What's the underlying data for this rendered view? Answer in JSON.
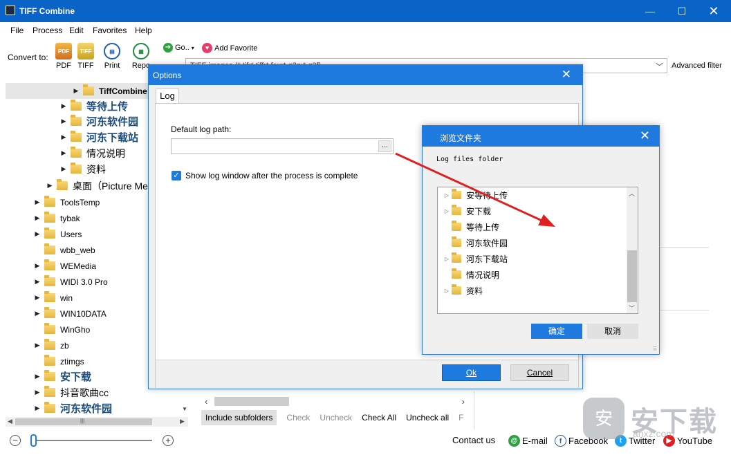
{
  "window": {
    "title": "TIFF Combine",
    "min_glyph": "—",
    "max_glyph": "☐",
    "close_glyph": "✕"
  },
  "menu": [
    "File",
    "Process",
    "Edit",
    "Favorites",
    "Help"
  ],
  "toolbar": {
    "convert_label": "Convert to:",
    "pdf_label": "PDF",
    "pdf_icon_text": "PDF",
    "tiff_label": "TIFF",
    "tiff_icon_text": "TIFF",
    "print_label": "Print",
    "report_label": "Repo",
    "goto_label": "Go..",
    "add_favorite_label": "Add Favorite",
    "filter_value": "TIFF images (*.tif;*.tiff;*.fax;*.g3n;*.g3f)",
    "advanced_filter_label": "Advanced filter"
  },
  "tree": {
    "items": [
      {
        "label": "TiffCombine",
        "style": "bold"
      },
      {
        "label": "等待上传",
        "style": "cn"
      },
      {
        "label": "河东软件园",
        "style": "cn"
      },
      {
        "label": "河东下载站",
        "style": "cn"
      },
      {
        "label": "情况说明",
        "style": "cn2"
      },
      {
        "label": "资料",
        "style": "cn2"
      },
      {
        "label": "桌面（Picture Men",
        "style": "cn2"
      },
      {
        "label": "ToolsTemp",
        "style": ""
      },
      {
        "label": "tybak",
        "style": ""
      },
      {
        "label": "Users",
        "style": ""
      },
      {
        "label": "wbb_web",
        "style": ""
      },
      {
        "label": "WEMedia",
        "style": ""
      },
      {
        "label": "WIDI 3.0 Pro",
        "style": ""
      },
      {
        "label": "win",
        "style": ""
      },
      {
        "label": "WIN10DATA",
        "style": ""
      },
      {
        "label": "WinGho",
        "style": ""
      },
      {
        "label": "zb",
        "style": ""
      },
      {
        "label": "ztimgs",
        "style": ""
      },
      {
        "label": "安下载",
        "style": "cn"
      },
      {
        "label": "抖音歌曲cc",
        "style": "cn2"
      },
      {
        "label": "河东软件园",
        "style": "cn"
      }
    ]
  },
  "checkbar": {
    "include_subfolders": "Include subfolders",
    "check": "Check",
    "uncheck": "Uncheck",
    "check_all": "Check All",
    "uncheck_all": "Uncheck all",
    "more": "F"
  },
  "status": {
    "contact_us": "Contact us",
    "email": "E-mail",
    "facebook": "Facebook",
    "twitter": "Twitter",
    "youtube": "YouTube",
    "zoom_minus": "−",
    "zoom_plus": "+"
  },
  "options_dialog": {
    "title": "Options",
    "tab_log": "Log",
    "default_log_path_label": "Default log path:",
    "default_log_path_value": "",
    "browse_button": "...",
    "show_log_window_label": "Show log window after the process is complete",
    "show_log_window_checked": true,
    "ok": "Ok",
    "cancel": "Cancel"
  },
  "browse_dialog": {
    "title": "浏览文件夹",
    "description": "Log files folder",
    "folders": [
      {
        "label": "安等待上传",
        "expandable": true
      },
      {
        "label": "安下载",
        "expandable": true
      },
      {
        "label": "等待上传",
        "expandable": false
      },
      {
        "label": "河东软件园",
        "expandable": false
      },
      {
        "label": "河东下载站",
        "expandable": true
      },
      {
        "label": "情况说明",
        "expandable": false
      },
      {
        "label": "资料",
        "expandable": true
      }
    ],
    "confirm": "确定",
    "cancel": "取消"
  },
  "watermark": {
    "main": "安下载",
    "sub": "anxz.com",
    "badge": "安"
  },
  "colors": {
    "accent": "#1f7ae0",
    "titlebar": "#0a64c8",
    "arrow": "#e02020"
  },
  "icons": [
    "app-icon",
    "pdf-icon",
    "tiff-icon",
    "print-icon",
    "report-icon",
    "goto-icon",
    "heart-icon",
    "folder-icon",
    "expand-arrow-icon",
    "checkbox-checked-icon",
    "email-icon",
    "facebook-icon",
    "twitter-icon",
    "youtube-icon",
    "red-annotation-arrow"
  ]
}
